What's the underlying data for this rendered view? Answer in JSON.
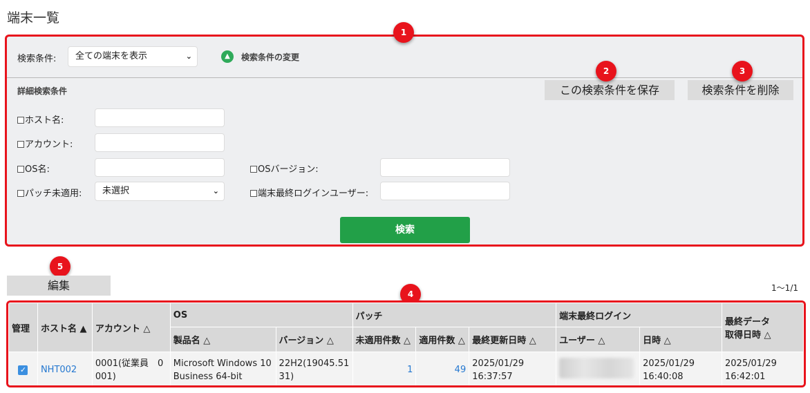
{
  "page": {
    "title": "端末一覧"
  },
  "conditions": {
    "label": "検索条件:",
    "selected": "全ての端末を表示",
    "change_label": "検索条件の変更",
    "detail_label": "詳細検索条件",
    "save_label": "この検索条件を保存",
    "delete_label": "検索条件を削除",
    "fields": {
      "host": "ホスト名:",
      "account": "アカウント:",
      "os_name": "OS名:",
      "os_version": "OSバージョン:",
      "patch": "パッチ未適用:",
      "patch_selected": "未選択",
      "last_login_user": "端末最終ログインユーザー:"
    },
    "search_label": "検索"
  },
  "badges": [
    "1",
    "2",
    "3",
    "4",
    "5"
  ],
  "toolbar": {
    "edit_label": "編集",
    "count": "1〜1/1"
  },
  "table": {
    "headers": {
      "manage": "管理",
      "host": "ホスト名 ▲",
      "account": "アカウント △",
      "os": "OS",
      "product": "製品名 △",
      "version": "バージョン △",
      "patch": "パッチ",
      "unapplied": "未適用件数 △",
      "applied": "適用件数 △",
      "last_update": "最終更新日時 △",
      "last_login": "端末最終ログイン",
      "user": "ユーザー △",
      "datetime": "日時 △",
      "last_data_1": "最終データ",
      "last_data_2": "取得日時 △"
    },
    "rows": [
      {
        "host": "NHT002",
        "account_1": "0001(従業員　0",
        "account_2": "001)",
        "product_1": "Microsoft Windows 10",
        "product_2": "Business 64-bit",
        "version_1": "22H2(19045.51",
        "version_2": "31)",
        "unapplied": "1",
        "applied": "49",
        "last_update_1": "2025/01/29",
        "last_update_2": "16:37:57",
        "login_1": "2025/01/29",
        "login_2": "16:40:08",
        "data_1": "2025/01/29",
        "data_2": "16:42:01"
      }
    ]
  },
  "colors": {
    "accent_red": "#e8131c",
    "search_green": "#22a048",
    "link_blue": "#2578d0"
  }
}
